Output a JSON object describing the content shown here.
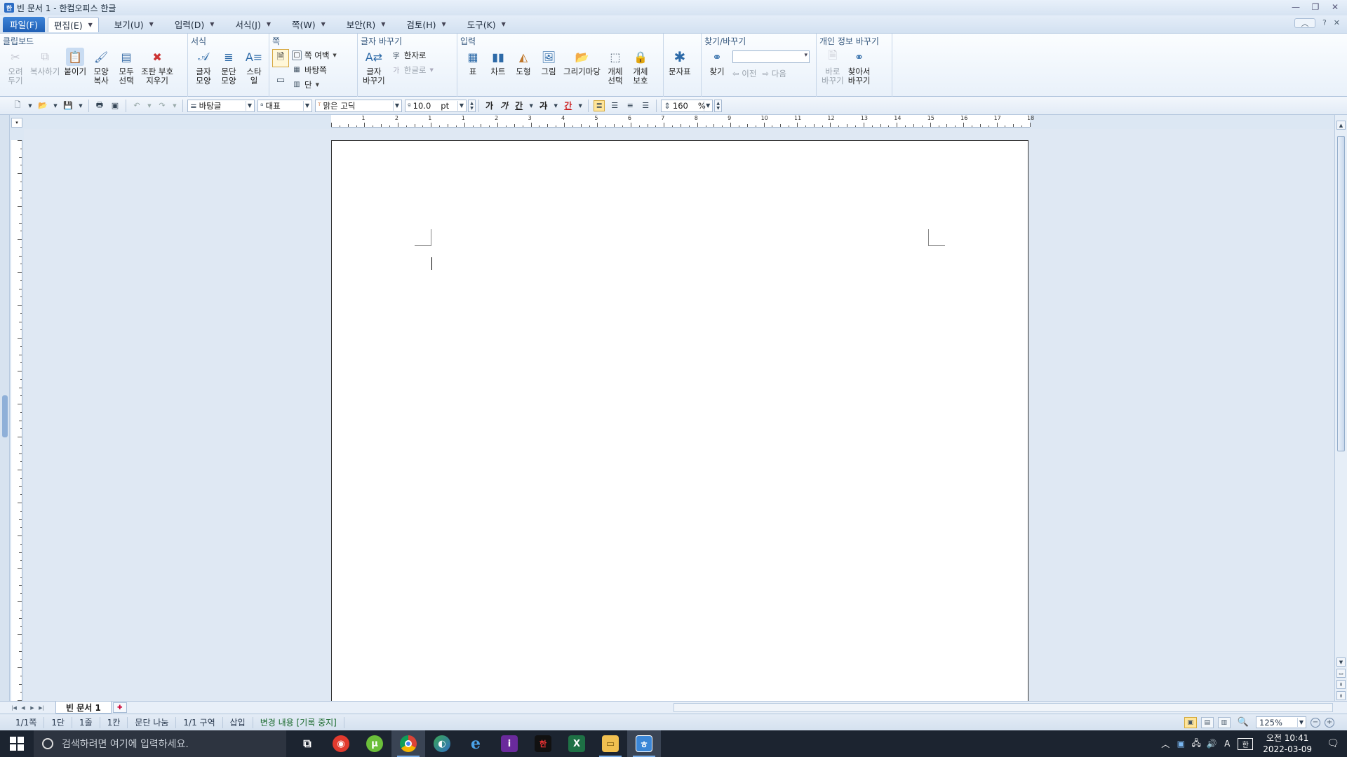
{
  "window": {
    "title": "빈 문서 1 - 한컴오피스 한글",
    "app_icon": "한"
  },
  "menu": {
    "items": [
      {
        "label": "파일(F)"
      },
      {
        "label": "편집(E)"
      },
      {
        "label": "보기(U)"
      },
      {
        "label": "입력(D)"
      },
      {
        "label": "서식(J)"
      },
      {
        "label": "쪽(W)"
      },
      {
        "label": "보안(R)"
      },
      {
        "label": "검토(H)"
      },
      {
        "label": "도구(K)"
      }
    ],
    "help": "?"
  },
  "ribbon": {
    "clipboard": {
      "title": "클립보드",
      "cut": "오려\n두기",
      "copy": "복사하기",
      "paste": "붙이기",
      "format_copy": "모양\n복사",
      "select_all": "모두\n선택",
      "clear_marks": "조판 부호\n지우기"
    },
    "format": {
      "title": "서식",
      "char_shape": "글자\n모양",
      "para_shape": "문단\n모양",
      "style": "스타일"
    },
    "page": {
      "title": "쪽",
      "margin": "쪽 여백",
      "background": "바탕쪽",
      "columns": "단"
    },
    "convert": {
      "title": "글자 바꾸기",
      "char_convert": "글자\n바꾸기",
      "to_hanja": "한자로",
      "to_hangul": "한글로"
    },
    "insert": {
      "title": "입력",
      "table": "표",
      "chart": "차트",
      "shape": "도형",
      "picture": "그림",
      "drawing": "그리기마당",
      "object_select": "개체\n선택",
      "object_protect": "개체\n보호"
    },
    "symbols": {
      "label": "문자표"
    },
    "find": {
      "title": "찾기/바꾸기",
      "find": "찾기",
      "prev": "이전",
      "next": "다음"
    },
    "privacy": {
      "title": "개인 정보 바꾸기",
      "replace_now": "바로\n바꾸기",
      "find_replace": "찾아서\n바꾸기"
    }
  },
  "toolbar": {
    "style": "바탕글",
    "lang": "대표",
    "font": "맑은 고딕",
    "font_size": "10.0",
    "unit": "pt",
    "bold": "가",
    "italic": "가",
    "underline": "간",
    "strike": "가",
    "color": "간",
    "line_spacing": "160",
    "line_spacing_unit": "%"
  },
  "ruler": {
    "h_numbers": [
      "1",
      "2",
      "1",
      "1",
      "2",
      "3",
      "4",
      "5",
      "6",
      "7",
      "8",
      "9",
      "10",
      "11",
      "12",
      "13",
      "14",
      "15",
      "16",
      "17",
      "18"
    ]
  },
  "tabbar": {
    "doc_tab": "빈 문서 1"
  },
  "status": {
    "page": "1/1쪽",
    "column": "1단",
    "line": "1줄",
    "char": "1칸",
    "para_break": "문단 나눔",
    "section": "1/1 구역",
    "mode": "삽입",
    "changes": "변경 내용 [기록 중지]",
    "zoom": "125%"
  },
  "taskbar": {
    "search_placeholder": "검색하려면 여기에 입력하세요.",
    "time": "오전 10:41",
    "date": "2022-03-09",
    "ime": "A",
    "lang_indicator": "한"
  }
}
